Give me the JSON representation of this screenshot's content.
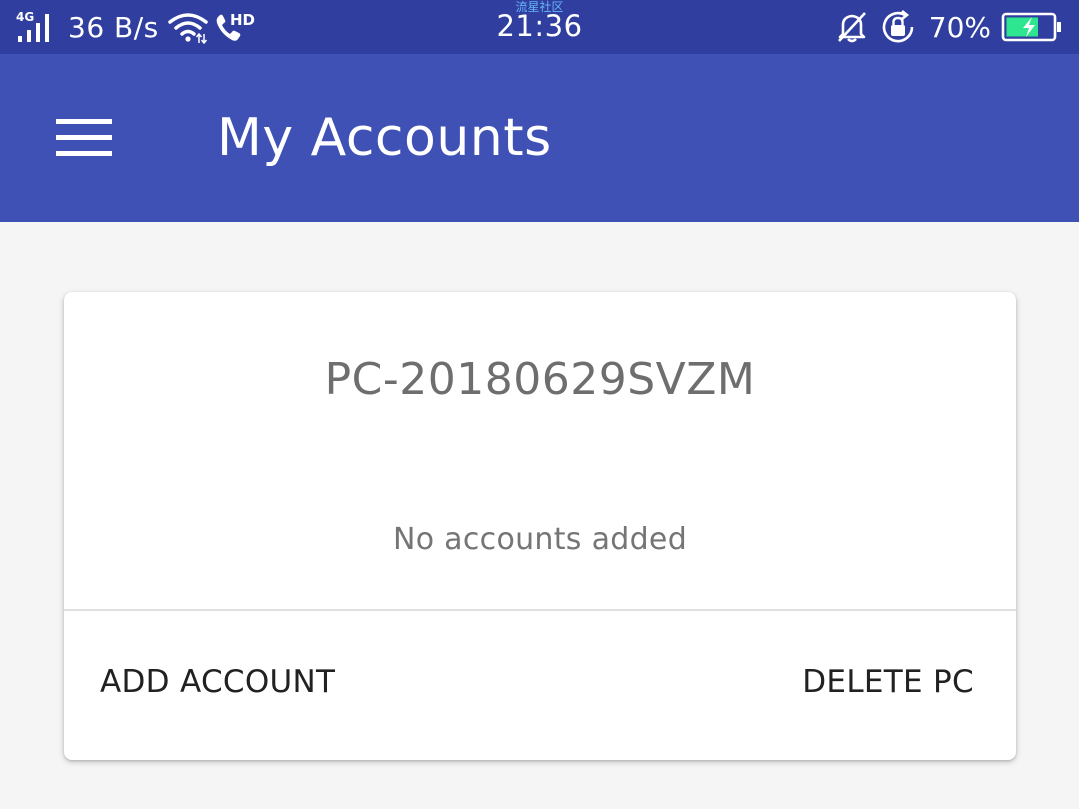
{
  "status_bar": {
    "network_type": "4G",
    "data_speed": "36 B/s",
    "hd_label": "HD",
    "watermark": "流星社区",
    "time": "21:36",
    "battery_percent": "70%",
    "battery_level": 0.7,
    "battery_color": "#2ee68f"
  },
  "app_bar": {
    "title": "My Accounts",
    "menu_icon": "hamburger-menu-icon",
    "color": "#3f51b5"
  },
  "card": {
    "pc_name": "PC-20180629SVZM",
    "empty_message": "No accounts added",
    "actions": {
      "add_account": "ADD ACCOUNT",
      "delete_pc": "DELETE PC"
    }
  }
}
